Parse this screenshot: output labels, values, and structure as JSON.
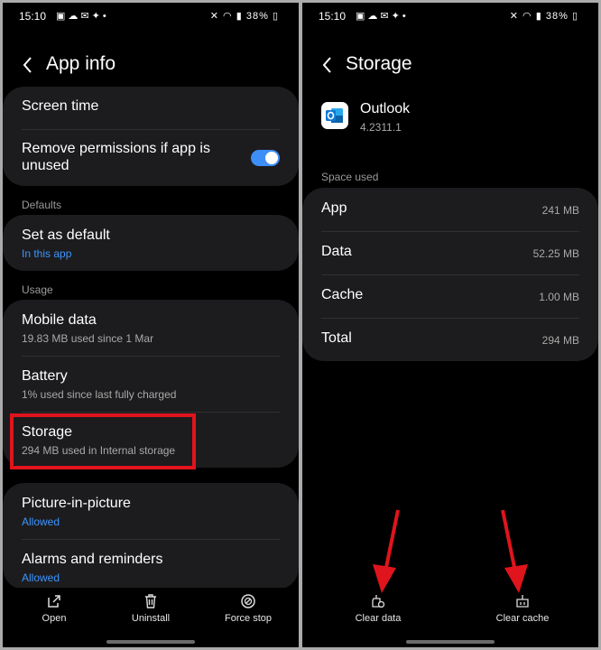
{
  "status_bar": {
    "time": "15:10",
    "battery": "38%"
  },
  "left": {
    "title": "App info",
    "screen_time": "Screen time",
    "remove_permissions": "Remove permissions if app is unused",
    "defaults_header": "Defaults",
    "set_as_default": {
      "label": "Set as default",
      "sub": "In this app"
    },
    "usage_header": "Usage",
    "mobile_data": {
      "label": "Mobile data",
      "sub": "19.83 MB used since 1 Mar"
    },
    "battery": {
      "label": "Battery",
      "sub": "1% used since last fully charged"
    },
    "storage": {
      "label": "Storage",
      "sub": "294 MB used in Internal storage"
    },
    "picture_in_picture": {
      "label": "Picture-in-picture",
      "sub": "Allowed"
    },
    "alarms": {
      "label": "Alarms and reminders",
      "sub": "Allowed"
    },
    "nav": {
      "open": "Open",
      "uninstall": "Uninstall",
      "force_stop": "Force stop"
    }
  },
  "right": {
    "title": "Storage",
    "app_name": "Outlook",
    "app_version": "4.2311.1",
    "space_used_header": "Space used",
    "rows": [
      {
        "label": "App",
        "value": "241 MB"
      },
      {
        "label": "Data",
        "value": "52.25 MB"
      },
      {
        "label": "Cache",
        "value": "1.00 MB"
      },
      {
        "label": "Total",
        "value": "294 MB"
      }
    ],
    "nav": {
      "clear_data": "Clear data",
      "clear_cache": "Clear cache"
    }
  },
  "colors": {
    "accent": "#3d95ff",
    "toggle": "#3e8ef7",
    "highlight": "#e0141c"
  },
  "icons": {
    "back": "chevron-left-icon",
    "open": "open-external-icon",
    "uninstall": "trash-icon",
    "force_stop": "stop-circle-icon",
    "clear_data": "clear-data-icon",
    "clear_cache": "clear-cache-icon",
    "app": "outlook-icon"
  }
}
